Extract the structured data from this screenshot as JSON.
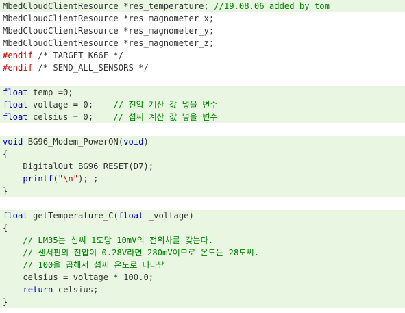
{
  "editor": {
    "lines": [
      {
        "bg": "hl",
        "tokens": [
          {
            "t": "MbedCloudClientResource *res_temperature; ",
            "c": "plain"
          },
          {
            "t": "//19.08.06 added by tom",
            "c": "cmt"
          }
        ]
      },
      {
        "bg": "pl",
        "tokens": [
          {
            "t": "MbedCloudClientResource *res_magnometer_x;",
            "c": "plain"
          }
        ]
      },
      {
        "bg": "pl",
        "tokens": [
          {
            "t": "MbedCloudClientResource *res_magnometer_y;",
            "c": "plain"
          }
        ]
      },
      {
        "bg": "pl",
        "tokens": [
          {
            "t": "MbedCloudClientResource *res_magnometer_z;",
            "c": "plain"
          }
        ]
      },
      {
        "bg": "pl",
        "tokens": [
          {
            "t": "#endif",
            "c": "pp"
          },
          {
            "t": " /* TARGET_K66F */",
            "c": "plain"
          }
        ]
      },
      {
        "bg": "pl",
        "tokens": [
          {
            "t": "#endif",
            "c": "pp"
          },
          {
            "t": " /* SEND_ALL_SENSORS */",
            "c": "plain"
          }
        ]
      },
      {
        "bg": "pl",
        "tokens": [
          {
            "t": "",
            "c": "plain"
          }
        ]
      },
      {
        "bg": "hl",
        "tokens": [
          {
            "t": "float",
            "c": "kw"
          },
          {
            "t": " temp =0;",
            "c": "plain"
          }
        ]
      },
      {
        "bg": "hl",
        "tokens": [
          {
            "t": "float",
            "c": "kw"
          },
          {
            "t": " voltage = 0;    ",
            "c": "plain"
          },
          {
            "t": "// 전압 계산 값 넣을 변수",
            "c": "cmt"
          }
        ]
      },
      {
        "bg": "hl",
        "tokens": [
          {
            "t": "float",
            "c": "kw"
          },
          {
            "t": " celsius = 0;    ",
            "c": "plain"
          },
          {
            "t": "// 섭씨 계산 값 넣을 변수",
            "c": "cmt"
          }
        ]
      },
      {
        "bg": "pl",
        "tokens": [
          {
            "t": "",
            "c": "plain"
          }
        ]
      },
      {
        "bg": "hl",
        "tokens": [
          {
            "t": "void",
            "c": "kw"
          },
          {
            "t": " BG96_Modem_PowerON(",
            "c": "plain"
          },
          {
            "t": "void",
            "c": "kw"
          },
          {
            "t": ")",
            "c": "plain"
          }
        ]
      },
      {
        "bg": "hl",
        "tokens": [
          {
            "t": "{",
            "c": "plain"
          }
        ]
      },
      {
        "bg": "hl",
        "tokens": [
          {
            "t": "    DigitalOut BG96_RESET(D7);",
            "c": "plain"
          }
        ]
      },
      {
        "bg": "hl",
        "tokens": [
          {
            "t": "    ",
            "c": "plain"
          },
          {
            "t": "printf",
            "c": "kw"
          },
          {
            "t": "(",
            "c": "plain"
          },
          {
            "t": "\"\\n\"",
            "c": "str"
          },
          {
            "t": "); ;",
            "c": "plain"
          }
        ]
      },
      {
        "bg": "hl",
        "tokens": [
          {
            "t": "}",
            "c": "plain"
          }
        ]
      },
      {
        "bg": "pl",
        "tokens": [
          {
            "t": "",
            "c": "plain"
          }
        ]
      },
      {
        "bg": "hl",
        "tokens": [
          {
            "t": "float",
            "c": "kw"
          },
          {
            "t": " getTemperature_C(",
            "c": "plain"
          },
          {
            "t": "float",
            "c": "kw"
          },
          {
            "t": " _voltage)",
            "c": "plain"
          }
        ]
      },
      {
        "bg": "hl",
        "tokens": [
          {
            "t": "{",
            "c": "plain"
          }
        ]
      },
      {
        "bg": "hl",
        "tokens": [
          {
            "t": "    ",
            "c": "plain"
          },
          {
            "t": "// LM35는 섭씨 1도당 10mV의 전위차를 갖는다.",
            "c": "cmt"
          }
        ]
      },
      {
        "bg": "hl",
        "tokens": [
          {
            "t": "    ",
            "c": "plain"
          },
          {
            "t": "// 센서핀의 전압이 0.28V라면 280mV이므로 온도는 28도씨.",
            "c": "cmt"
          }
        ]
      },
      {
        "bg": "hl",
        "tokens": [
          {
            "t": "    ",
            "c": "plain"
          },
          {
            "t": "// 100을 곱해서 섭씨 온도로 나타냄",
            "c": "cmt"
          }
        ]
      },
      {
        "bg": "hl",
        "tokens": [
          {
            "t": "    celsius = voltage * 100.0;",
            "c": "plain"
          }
        ]
      },
      {
        "bg": "hl",
        "tokens": [
          {
            "t": "    ",
            "c": "plain"
          },
          {
            "t": "return",
            "c": "kw"
          },
          {
            "t": " celsius;",
            "c": "plain"
          }
        ]
      },
      {
        "bg": "hl",
        "tokens": [
          {
            "t": "}",
            "c": "plain"
          }
        ]
      }
    ]
  }
}
